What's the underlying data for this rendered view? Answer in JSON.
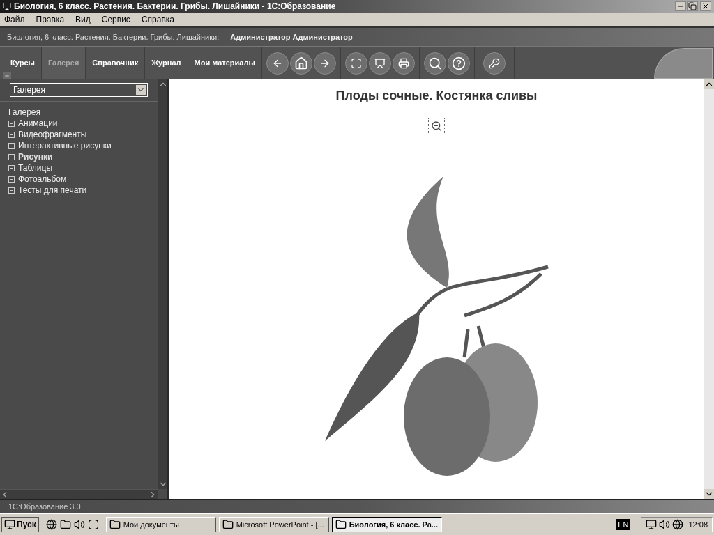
{
  "window": {
    "title": "Биология, 6 класс. Растения. Бактерии. Грибы. Лишайники - 1С:Образование"
  },
  "menu": [
    "Файл",
    "Правка",
    "Вид",
    "Сервис",
    "Справка"
  ],
  "header": {
    "course": "Биология, 6 класс. Растения. Бактерии. Грибы. Лишайники:",
    "user": "Администратор Администратор"
  },
  "tabs": [
    {
      "label": "Курсы",
      "selected": false
    },
    {
      "label": "Галерея",
      "selected": true
    },
    {
      "label": "Справочник",
      "selected": false
    },
    {
      "label": "Журнал",
      "selected": false
    },
    {
      "label": "Мои материалы",
      "selected": false
    }
  ],
  "sidebar": {
    "dropdown": "Галерея",
    "root": "Галерея",
    "items": [
      {
        "label": "Анимации",
        "selected": false
      },
      {
        "label": "Видеофрагменты",
        "selected": false
      },
      {
        "label": "Интерактивные рисунки",
        "selected": false
      },
      {
        "label": "Рисунки",
        "selected": true
      },
      {
        "label": "Таблицы",
        "selected": false
      },
      {
        "label": "Фотоальбом",
        "selected": false
      },
      {
        "label": "Тесты для печати",
        "selected": false
      }
    ]
  },
  "content": {
    "title": "Плоды сочные. Костянка сливы"
  },
  "status_bar": "1С:Образование 3.0",
  "taskbar": {
    "start": "Пуск",
    "buttons": [
      {
        "label": "Мои документы",
        "selected": false
      },
      {
        "label": "Microsoft PowerPoint - [...",
        "selected": false
      },
      {
        "label": "Биология, 6 класс. Ра...",
        "selected": true
      }
    ],
    "language": "EN",
    "clock": "12:08"
  }
}
